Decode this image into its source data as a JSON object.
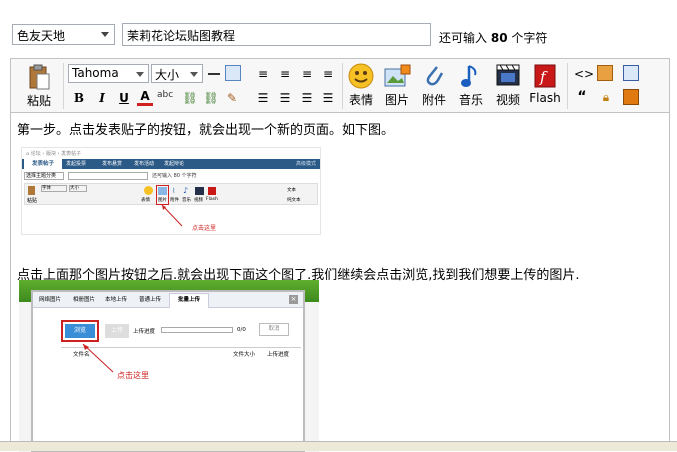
{
  "form": {
    "forum_select": "色友天地",
    "subject_value": "茉莉花论坛贴图教程",
    "remain_prefix": "还可输入",
    "remain_count": "80",
    "remain_suffix": "个字符"
  },
  "toolbar": {
    "paste_label": "粘贴",
    "font_family": "Tahoma",
    "font_size": "大小",
    "emoticon_label": "表情",
    "image_label": "图片",
    "attach_label": "附件",
    "music_label": "音乐",
    "video_label": "视频",
    "flash_label": "Flash",
    "bold": "B",
    "italic": "I",
    "underline": "U",
    "font_color": "A",
    "abc": "abc",
    "quote": "“"
  },
  "content": {
    "step1": "第一步。点击发表贴子的按钮，就会出现一个新的页面。如下图。",
    "step2": "点击上面那个图片按钮之后.就会出现下面这个图了.我们继续会点击浏览,找到我们想要上传的图片.",
    "shot1": {
      "tab": "发表帖子",
      "tabs_gray": [
        "发起投票",
        "发布悬赏",
        "发布活动",
        "发起辩论"
      ],
      "link": "高级模式",
      "select": "选择主题分类",
      "remain": "还可输入 80 个字符",
      "font": "字体",
      "size": "大小",
      "btn_labels": [
        "表情",
        "图片",
        "附件",
        "音乐",
        "视频",
        "Flash"
      ],
      "right_labels": [
        "文本",
        "纯文本"
      ],
      "hint": "点击这里",
      "paste": "粘贴"
    },
    "shot2": {
      "tabs": [
        "网络图片",
        "相册图片",
        "本地上传",
        "普通上传",
        "批量上传"
      ],
      "browse": "浏览",
      "upload": "上传",
      "progress_label": "上传进度",
      "progress_value": "0/0",
      "cancel": "取消",
      "col_name": "文件名",
      "col_size": "文件大小",
      "col_progress": "上传进度",
      "hint": "点击这里"
    }
  }
}
